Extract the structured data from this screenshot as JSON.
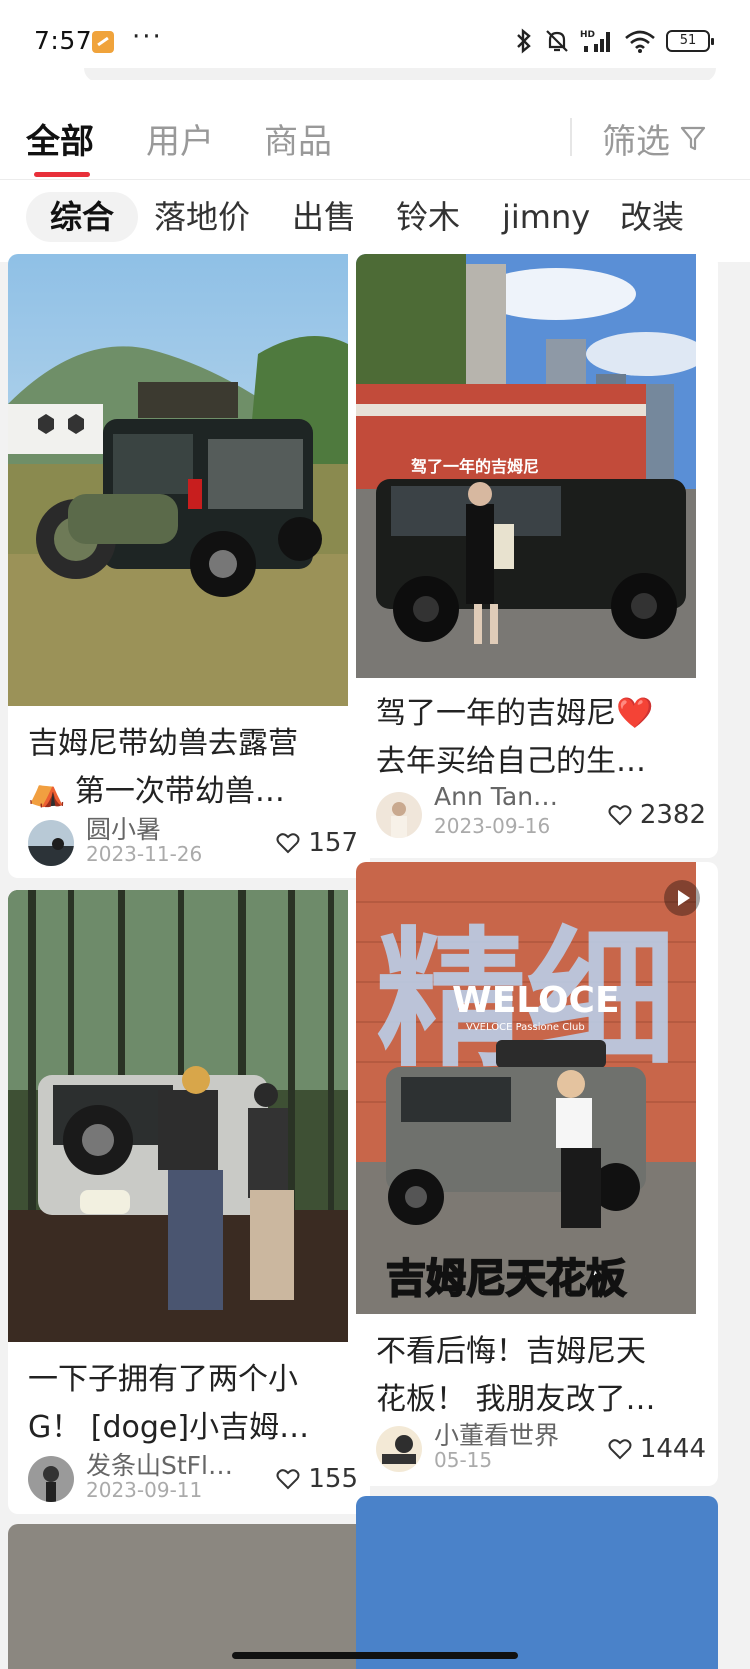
{
  "status_bar": {
    "time": "7:57",
    "more": "···",
    "battery": "51"
  },
  "tabs": [
    {
      "label": "全部",
      "active": true
    },
    {
      "label": "用户",
      "active": false
    },
    {
      "label": "商品",
      "active": false
    }
  ],
  "filter": {
    "label": "筛选",
    "icon": "funnel-icon"
  },
  "chips": [
    "综合",
    "落地价",
    "出售",
    "铃木",
    "jimny",
    "改装"
  ],
  "cards": [
    {
      "title_lines": [
        "吉姆尼带幼兽去露营",
        "⛺ 第一次带幼兽…"
      ],
      "author": "圆小暑",
      "date": "2023-11-26",
      "likes": "157"
    },
    {
      "image_caption": "驾了一年的吉姆尼",
      "title_lines": [
        "驾了一年的吉姆尼❤️",
        "去年买给自己的生…"
      ],
      "author": "Ann Tan…",
      "date": "2023-09-16",
      "likes": "2382"
    },
    {
      "title_lines": [
        "一下子拥有了两个小",
        "G！ [doge]小吉姆…"
      ],
      "author": "发条山StFl…",
      "date": "2023-09-11",
      "likes": "155"
    },
    {
      "image_big_text": "精细",
      "image_brand": "WELOCE",
      "image_brand_sub": "VVELOCE Passione Club",
      "image_bottom_text": "吉姆尼天花板",
      "title_lines": [
        "不看后悔！吉姆尼天",
        "花板！ 我朋友改了…"
      ],
      "author": "小董看世界",
      "date": "05-15",
      "likes": "1444"
    }
  ],
  "colors": {
    "accent": "#e8303a",
    "tab_inactive": "#999999",
    "bg": "#f2f2f2"
  }
}
